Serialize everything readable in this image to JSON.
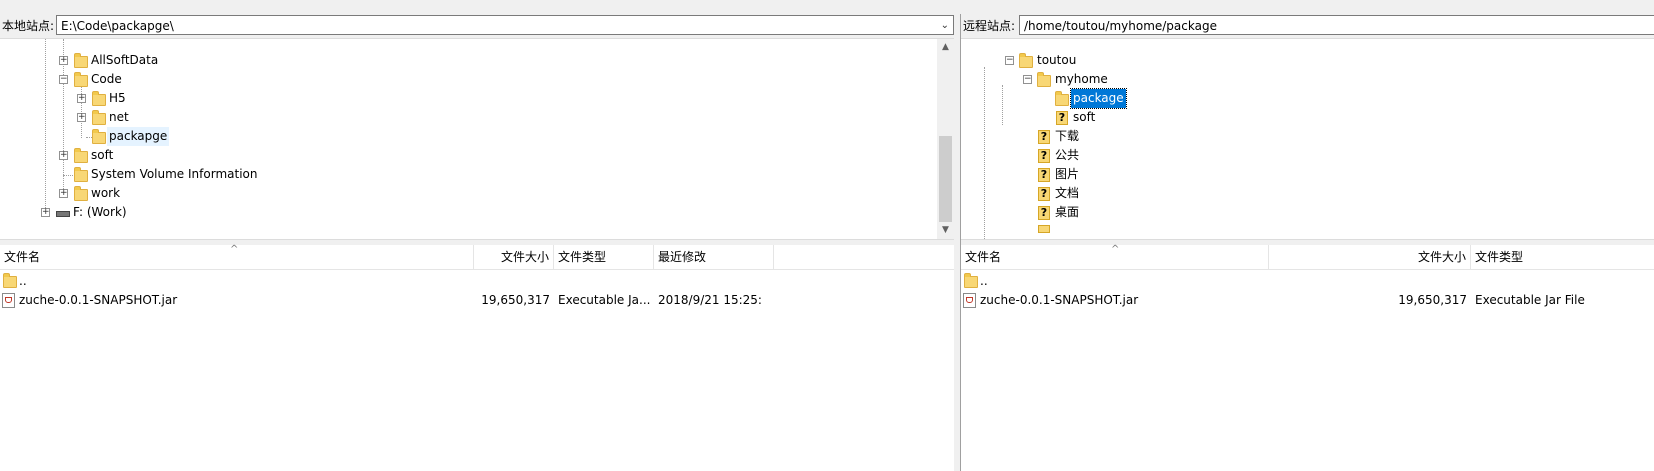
{
  "local": {
    "address_label": "本地站点:",
    "path": "E:\\Code\\packapge\\",
    "tree": [
      {
        "label": "AllSoftData"
      },
      {
        "label": "Code"
      },
      {
        "label": "H5"
      },
      {
        "label": "net"
      },
      {
        "label": "packapge"
      },
      {
        "label": "soft"
      },
      {
        "label": "System Volume Information"
      },
      {
        "label": "work"
      },
      {
        "label": "F: (Work)"
      }
    ],
    "columns": [
      "文件名",
      "文件大小",
      "文件类型",
      "最近修改"
    ],
    "files": [
      {
        "name": "..",
        "size": "",
        "type": "",
        "modified": ""
      },
      {
        "name": "zuche-0.0.1-SNAPSHOT.jar",
        "size": "19,650,317",
        "type": "Executable Ja...",
        "modified": "2018/9/21 15:25:"
      }
    ]
  },
  "remote": {
    "address_label": "远程站点:",
    "path": "/home/toutou/myhome/package",
    "tree": [
      {
        "label": "toutou"
      },
      {
        "label": "myhome"
      },
      {
        "label": "package"
      },
      {
        "label": "soft"
      },
      {
        "label": "下载"
      },
      {
        "label": "公共"
      },
      {
        "label": "图片"
      },
      {
        "label": "文档"
      },
      {
        "label": "桌面"
      }
    ],
    "columns": [
      "文件名",
      "文件大小",
      "文件类型"
    ],
    "files": [
      {
        "name": "..",
        "size": "",
        "type": ""
      },
      {
        "name": "zuche-0.0.1-SNAPSHOT.jar",
        "size": "19,650,317",
        "type": "Executable Jar File"
      }
    ]
  },
  "icons": {
    "expand": "+",
    "collapse": "−",
    "unknown": "?",
    "dropdown": "⌄",
    "scroll_up": "▲",
    "scroll_down": "▼",
    "sort_caret": "^"
  }
}
